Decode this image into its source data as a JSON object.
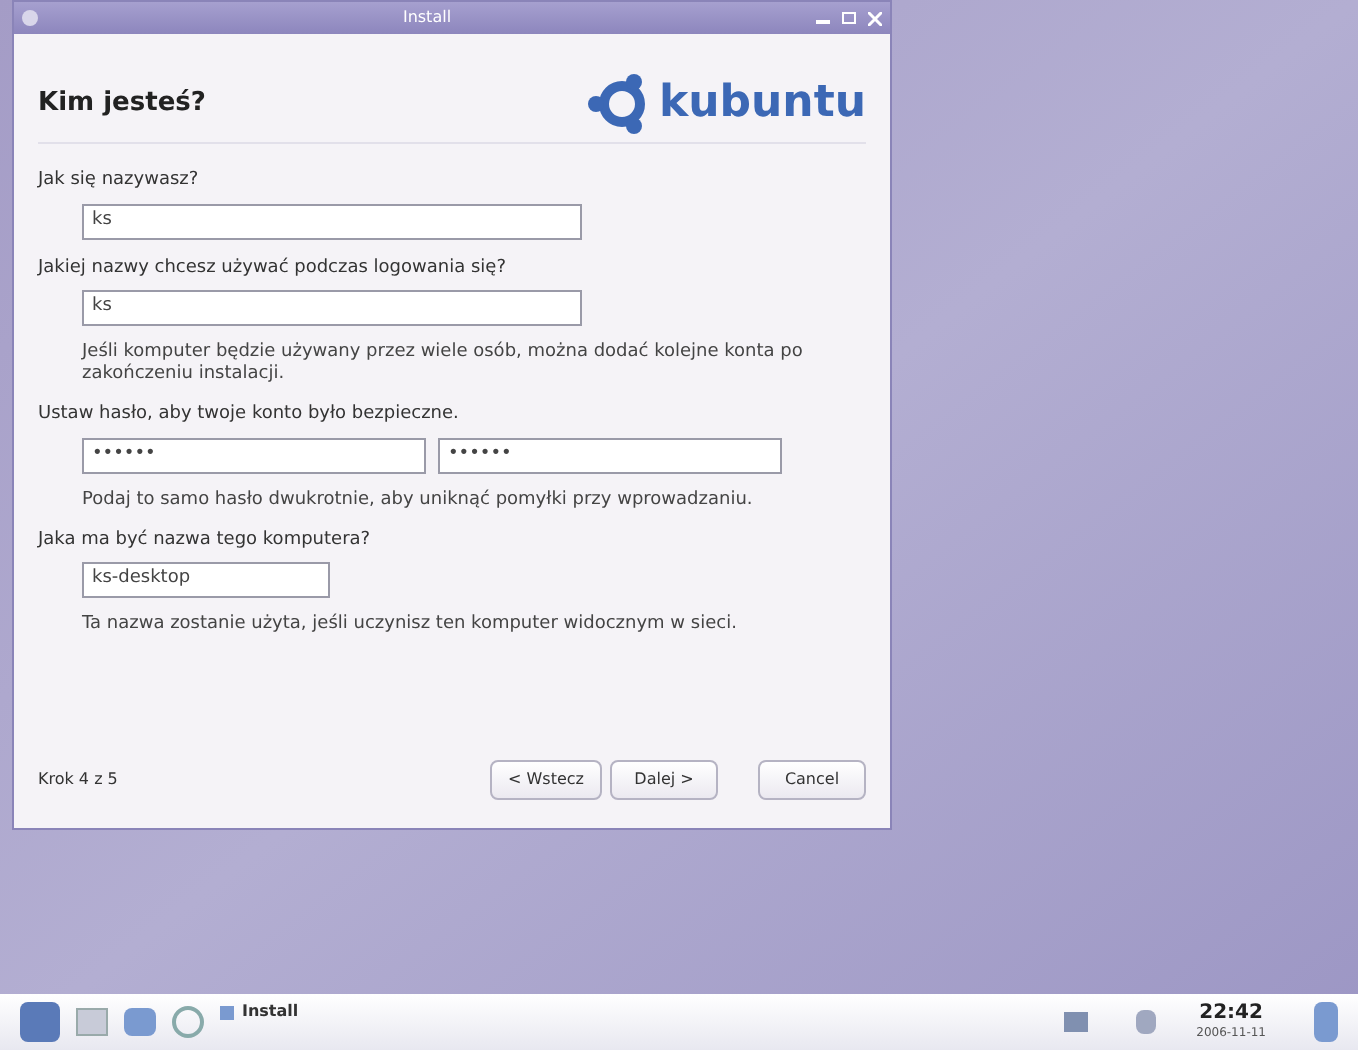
{
  "window": {
    "title": "Install"
  },
  "heading": "Kim jesteś?",
  "logo_text": "kubuntu",
  "form": [
    {
      "kind": "label",
      "text": "Jak się nazywasz?"
    },
    {
      "kind": "field",
      "value": "ks"
    },
    {
      "kind": "label",
      "text": "Jakiej nazwy chcesz używać podczas logowania się?"
    },
    {
      "kind": "field",
      "value": "ks"
    },
    {
      "kind": "hint",
      "text": "Jeśli komputer będzie używany przez wiele osób, można dodać kolejne konta po zakończeniu instalacji."
    },
    {
      "kind": "label",
      "text": "Ustaw hasło, aby twoje konto było bezpieczne."
    },
    {
      "kind": "password_pair",
      "values": [
        "••••••",
        "••••••"
      ]
    },
    {
      "kind": "hint",
      "text": "Podaj to samo hasło dwukrotnie, aby uniknąć pomyłki przy wprowadzaniu."
    },
    {
      "kind": "label",
      "text": "Jaka ma być nazwa tego komputera?"
    },
    {
      "kind": "short_field",
      "value": "ks-desktop"
    },
    {
      "kind": "hint",
      "text": "Ta nazwa zostanie użyta, jeśli uczynisz ten komputer widocznym w sieci."
    }
  ],
  "step": "Krok 4 z 5",
  "buttons": [
    "< Wstecz",
    "Dalej >",
    "Cancel"
  ],
  "taskbar": {
    "task": "Install",
    "time": "22:42",
    "date": "2006-11-11"
  }
}
